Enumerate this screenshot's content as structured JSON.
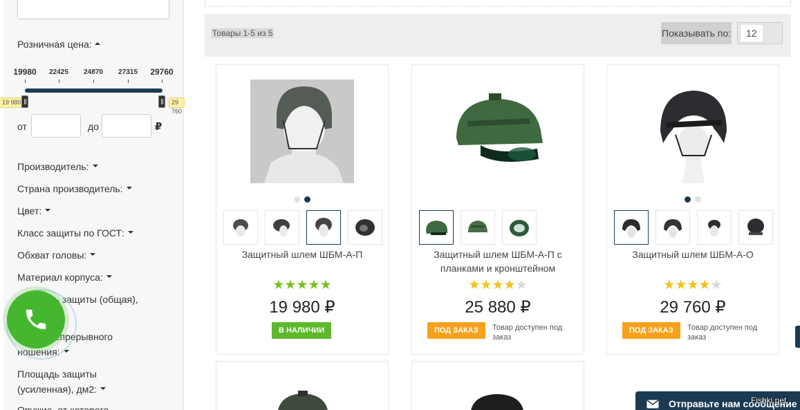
{
  "sidebar": {
    "price_title": "Розничная цена:",
    "range": {
      "min": "19980",
      "ticks": [
        "22425",
        "24870",
        "27315"
      ],
      "max": "29760",
      "min_tag": "19 980",
      "max_tag": "29 760",
      "from_label": "от",
      "to_label": "до",
      "currency": "₽"
    },
    "filters": [
      "Производитель:",
      "Страна производитель:",
      "Цвет:",
      "Класс защиты по ГОСТ:",
      "Обхват головы:",
      "Материал корпуса:",
      "Площадь защиты (общая), дм2:",
      "Время непрерывного ношения:",
      "Площадь защиты (усиленная), дм2:",
      "Оружие, от которого"
    ]
  },
  "toolbar": {
    "count_text": "Товары 1-5 из 5",
    "show_label": "Показывать по:",
    "show_value": "12"
  },
  "products": [
    {
      "name": "Защитный шлем ШБМ-А-П",
      "rating": 5,
      "price": "19 980 ₽",
      "status": "В НАЛИЧИИ",
      "note": ""
    },
    {
      "name": "Защитный шлем ШБМ-А-П с планками и кронштейном",
      "rating": 4,
      "price": "25 880 ₽",
      "status": "ПОД ЗАКАЗ",
      "note": "Товар доступен под заказ"
    },
    {
      "name": "Защитный шлем ШБМ-А-О",
      "rating": 4,
      "price": "29 760 ₽",
      "status": "ПОД ЗАКАЗ",
      "note": "Товар доступен под заказ"
    }
  ],
  "chat": {
    "label": "Отправьте нам сообщение"
  },
  "watermark": "Fishki.net",
  "colors": {
    "accent": "#1c3a52",
    "in_stock": "#5db82c",
    "on_order": "#f7a11a",
    "star": "#f2c21d",
    "star_green": "#7bbf1e"
  }
}
